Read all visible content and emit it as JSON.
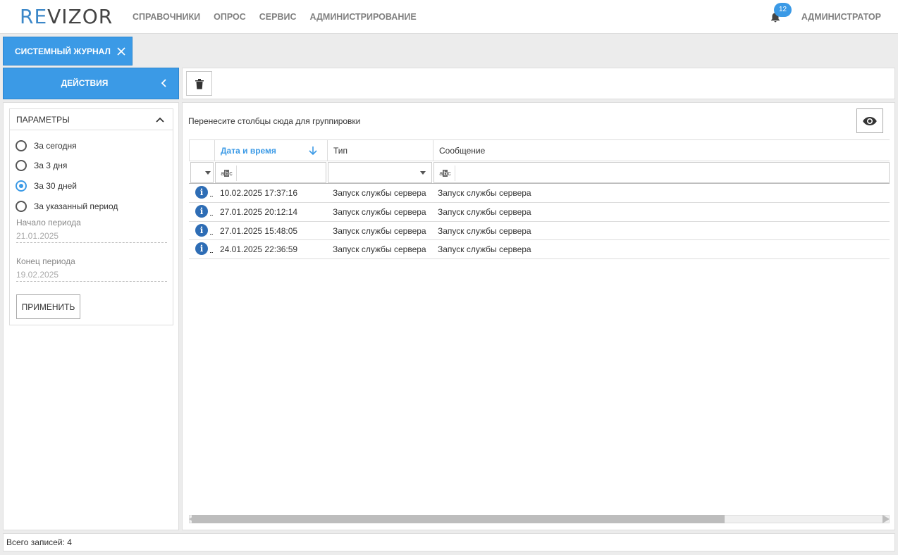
{
  "header": {
    "logo_re": "RE",
    "logo_vizor": "VIZOR",
    "nav": [
      {
        "label": "СПРАВОЧНИКИ",
        "name": "nav-directories"
      },
      {
        "label": "ОПРОС",
        "name": "nav-poll"
      },
      {
        "label": "СЕРВИС",
        "name": "nav-service"
      },
      {
        "label": "АДМИНИСТРИРОВАНИЕ",
        "name": "nav-administration"
      }
    ],
    "notification_count": "12",
    "user": "АДМИНИСТРАТОР"
  },
  "tab": {
    "label": "СИСТЕМНЫЙ ЖУРНАЛ"
  },
  "actions": {
    "label": "ДЕЙСТВИЯ"
  },
  "params": {
    "title": "ПАРАМЕТРЫ",
    "options": [
      {
        "label": "За сегодня",
        "checked": false
      },
      {
        "label": "За 3 дня",
        "checked": false
      },
      {
        "label": "За 30 дней",
        "checked": true
      },
      {
        "label": "За указанный период",
        "checked": false
      }
    ],
    "start_label": "Начало периода",
    "start_value": "21.01.2025",
    "end_label": "Конец периода",
    "end_value": "19.02.2025",
    "apply_label": "ПРИМЕНИТЬ"
  },
  "grid": {
    "group_hint": "Перенесите столбцы сюда для группировки",
    "columns": [
      "Дата и время",
      "Тип",
      "Сообщение"
    ],
    "rows": [
      {
        "datetime": "10.02.2025 17:37:16",
        "type": "Запуск службы сервера",
        "message": "Запуск службы сервера"
      },
      {
        "datetime": "27.01.2025 20:12:14",
        "type": "Запуск службы сервера",
        "message": "Запуск службы сервера"
      },
      {
        "datetime": "27.01.2025 15:48:05",
        "type": "Запуск службы сервера",
        "message": "Запуск службы сервера"
      },
      {
        "datetime": "24.01.2025 22:36:59",
        "type": "Запуск службы сервера",
        "message": "Запуск службы сервера"
      }
    ]
  },
  "status": {
    "text": "Всего записей: 4"
  },
  "colors": {
    "accent": "#3b9ae6",
    "info_icon": "#2e6db5"
  }
}
